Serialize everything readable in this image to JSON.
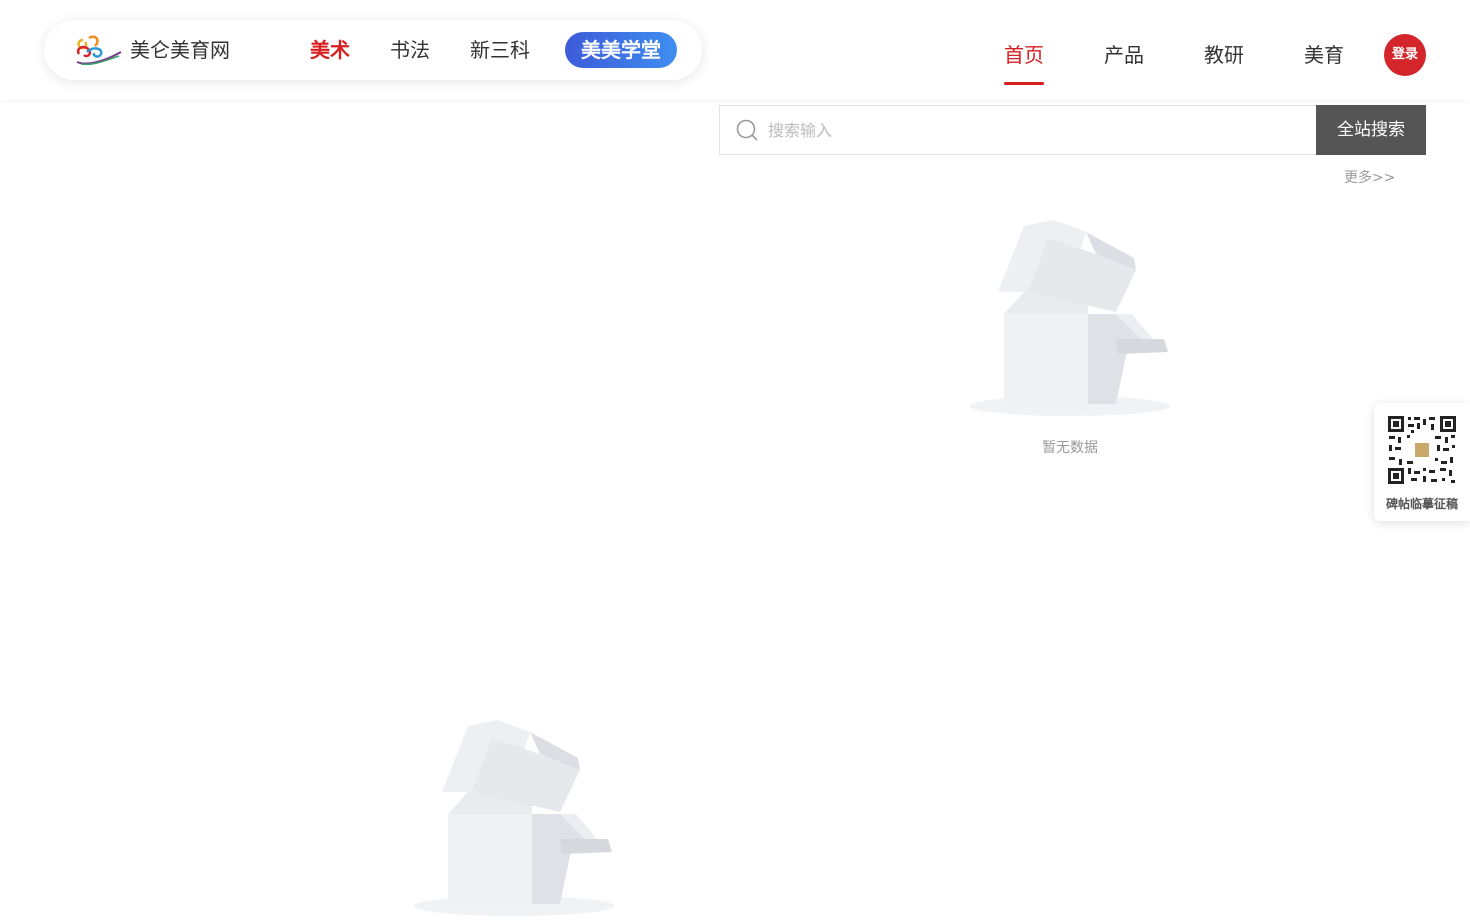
{
  "header": {
    "site_name": "美仑美育网",
    "categories": [
      {
        "label": "美术",
        "active": true
      },
      {
        "label": "书法",
        "active": false
      },
      {
        "label": "新三科",
        "active": false
      }
    ],
    "featured_category": "美美学堂",
    "nav": [
      {
        "label": "首页",
        "active": true
      },
      {
        "label": "产品",
        "active": false
      },
      {
        "label": "教研",
        "active": false
      },
      {
        "label": "美育",
        "active": false
      }
    ],
    "login_label": "登录"
  },
  "search": {
    "placeholder": "搜索输入",
    "value": "",
    "button_label": "全站搜索",
    "more_link": "更多>>"
  },
  "empty_state": {
    "text": "暂无数据",
    "icon": "empty-box-icon"
  },
  "qr_widget": {
    "caption": "碑帖临摹征稿",
    "icon": "qr-code-icon"
  },
  "colors": {
    "accent": "#d81e1e",
    "login_bg": "#d3252a",
    "search_button_bg": "#555555",
    "featured_gradient_start": "#3d5bd8",
    "featured_gradient_end": "#3f8ef0"
  }
}
